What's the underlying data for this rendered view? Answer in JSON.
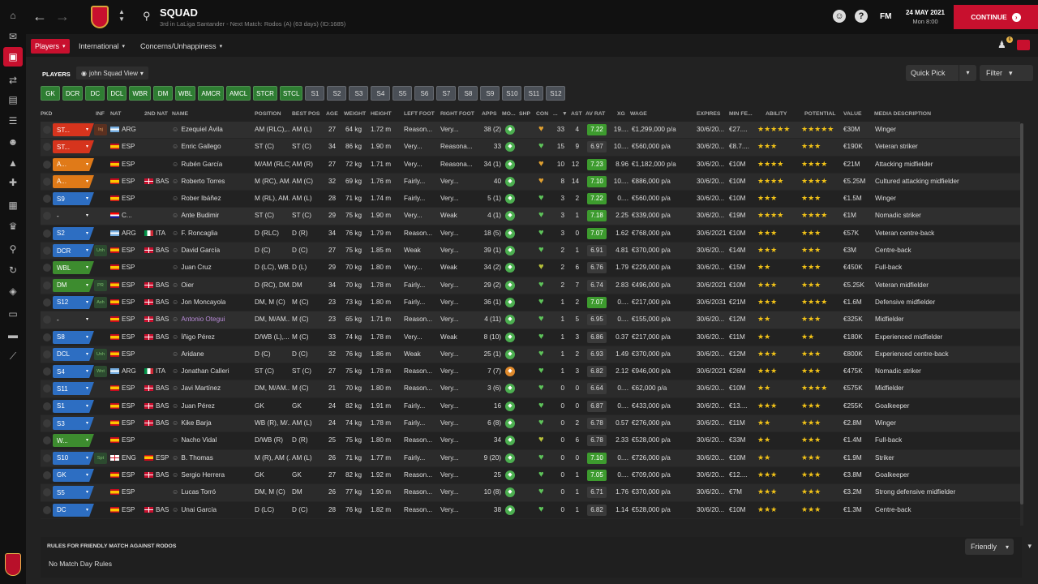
{
  "window": {
    "title": "SQUAD",
    "subtitle": "3rd in LaLiga Santander - Next Match: Rodos (A) (63 days) (ID:1685)",
    "date": "24 MAY 2021",
    "time": "Mon 8:00",
    "fm": "FM",
    "continue": "CONTINUE",
    "badge_count": "6"
  },
  "menus": {
    "players": "Players",
    "international": "International",
    "concerns": "Concerns/Unhappiness"
  },
  "list": {
    "heading": "PLAYERS",
    "view": "john Squad View",
    "quickpick": "Quick Pick",
    "filter": "Filter"
  },
  "positions": [
    "GK",
    "DCR",
    "DC",
    "DCL",
    "WBR",
    "DM",
    "WBL",
    "AMCR",
    "AMCL",
    "STCR",
    "STCL"
  ],
  "slots": [
    "S1",
    "S2",
    "S3",
    "S4",
    "S5",
    "S6",
    "S7",
    "S8",
    "S9",
    "S10",
    "S11",
    "S12"
  ],
  "columns": {
    "pkd": "PKD",
    "inf": "INF",
    "nat": "NAT",
    "nat2": "2ND NAT",
    "name": "NAME",
    "position": "POSITION",
    "bestpos": "BEST POS",
    "age": "AGE",
    "weight": "WEIGHT",
    "height": "HEIGHT",
    "lfoot": "LEFT FOOT",
    "rfoot": "RIGHT FOOT",
    "apps": "APPS",
    "mo": "MO...",
    "shp": "SHP",
    "con": "CON",
    "gls": "...",
    "ast": "AST",
    "avrat": "AV RAT",
    "xg": "XG",
    "wage": "WAGE",
    "expires": "EXPIRES",
    "minfee": "MIN FE...",
    "ability": "ABILITY",
    "potential": "POTENTIAL",
    "value": "VALUE",
    "media": "MEDIA DESCRIPTION"
  },
  "colors": {
    "accent": "#c8102e",
    "green": "#2e7d32",
    "slot": "#4a4f56"
  },
  "players": [
    {
      "pkd": "ST...",
      "pc": "red",
      "inf": "Inj",
      "ic": "red",
      "nat": "ARG",
      "nf": "arg",
      "nat2": "",
      "n2f": "",
      "name": "Ezequiel Ávila",
      "pos": "AM (RLC),...",
      "best": "AM (L)",
      "age": "27",
      "wt": "64 kg",
      "ht": "1.72 m",
      "lf": "Reason...",
      "rf": "Very...",
      "apps": "38 (2)",
      "mor": "g",
      "con": "o",
      "gls": "33",
      "ast": "4",
      "av": "7.22",
      "avc": "g",
      "xg": "19....",
      "wage": "€1,299,000 p/a",
      "exp": "30/6/20...",
      "fee": "€27....",
      "ab": "5",
      "po": "5",
      "val": "€30M",
      "media": "Winger",
      "sel": true
    },
    {
      "pkd": "ST...",
      "pc": "red",
      "inf": "",
      "ic": "",
      "nat": "ESP",
      "nf": "esp",
      "nat2": "",
      "n2f": "",
      "name": "Enric Gallego",
      "pos": "ST (C)",
      "best": "ST (C)",
      "age": "34",
      "wt": "86 kg",
      "ht": "1.90 m",
      "lf": "Very...",
      "rf": "Reasona...",
      "apps": "33",
      "mor": "g",
      "con": "g",
      "gls": "15",
      "ast": "9",
      "av": "6.97",
      "avc": "n",
      "xg": "10....",
      "wage": "€560,000 p/a",
      "exp": "30/6/20...",
      "fee": "€8.7....",
      "ab": "3",
      "po": "3",
      "val": "€190K",
      "media": "Veteran striker"
    },
    {
      "pkd": "A...",
      "pc": "ora",
      "inf": "",
      "ic": "",
      "nat": "ESP",
      "nf": "esp",
      "nat2": "",
      "n2f": "",
      "name": "Rubén García",
      "pos": "M/AM (RLC)",
      "best": "AM (R)",
      "age": "27",
      "wt": "72 kg",
      "ht": "1.71 m",
      "lf": "Very...",
      "rf": "Reasona...",
      "apps": "34 (1)",
      "mor": "g",
      "con": "o",
      "gls": "10",
      "ast": "12",
      "av": "7.23",
      "avc": "g",
      "xg": "8.96",
      "wage": "€1,182,000 p/a",
      "exp": "30/6/20...",
      "fee": "€10M",
      "ab": "4",
      "po": "4",
      "val": "€21M",
      "media": "Attacking midfielder"
    },
    {
      "pkd": "A...",
      "pc": "ora",
      "inf": "",
      "ic": "",
      "nat": "ESP",
      "nf": "esp",
      "nat2": "BAS",
      "n2f": "bas",
      "name": "Roberto Torres",
      "pos": "M (RC), AM...",
      "best": "AM (C)",
      "age": "32",
      "wt": "69 kg",
      "ht": "1.76 m",
      "lf": "Fairly...",
      "rf": "Very...",
      "apps": "40",
      "mor": "g",
      "con": "o",
      "gls": "8",
      "ast": "14",
      "av": "7.10",
      "avc": "g",
      "xg": "10....",
      "wage": "€886,000 p/a",
      "exp": "30/6/20...",
      "fee": "€10M",
      "ab": "4",
      "po": "4",
      "val": "€5.25M",
      "media": "Cultured attacking midfielder"
    },
    {
      "pkd": "S9",
      "pc": "blu",
      "inf": "",
      "ic": "",
      "nat": "ESP",
      "nf": "esp",
      "nat2": "",
      "n2f": "",
      "name": "Rober Ibáñez",
      "pos": "M (RL), AM...",
      "best": "AM (L)",
      "age": "28",
      "wt": "71 kg",
      "ht": "1.74 m",
      "lf": "Fairly...",
      "rf": "Very...",
      "apps": "5 (1)",
      "mor": "g",
      "con": "g",
      "gls": "3",
      "ast": "2",
      "av": "7.22",
      "avc": "g",
      "xg": "0....",
      "wage": "€560,000 p/a",
      "exp": "30/6/20...",
      "fee": "€10M",
      "ab": "3.5",
      "po": "3.5",
      "val": "€1.5M",
      "media": "Winger"
    },
    {
      "pkd": "-",
      "pc": "none",
      "inf": "",
      "ic": "",
      "nat": "C...",
      "nf": "cro",
      "nat2": "",
      "n2f": "",
      "name": "Ante Budimir",
      "pos": "ST (C)",
      "best": "ST (C)",
      "age": "29",
      "wt": "75 kg",
      "ht": "1.90 m",
      "lf": "Very...",
      "rf": "Weak",
      "apps": "4 (1)",
      "mor": "g",
      "con": "g",
      "gls": "3",
      "ast": "1",
      "av": "7.18",
      "avc": "g",
      "xg": "2.25",
      "wage": "€339,000 p/a",
      "exp": "30/6/20...",
      "fee": "€19M",
      "ab": "4",
      "po": "4",
      "val": "€1M",
      "media": "Nomadic striker",
      "sel": true
    },
    {
      "pkd": "S2",
      "pc": "blu",
      "inf": "",
      "ic": "",
      "nat": "ARG",
      "nf": "arg",
      "nat2": "ITA",
      "n2f": "ita",
      "name": "F. Roncaglia",
      "pos": "D (RLC)",
      "best": "D (R)",
      "age": "34",
      "wt": "76 kg",
      "ht": "1.79 m",
      "lf": "Reason...",
      "rf": "Very...",
      "apps": "18 (5)",
      "mor": "g",
      "con": "g",
      "gls": "3",
      "ast": "0",
      "av": "7.07",
      "avc": "g",
      "xg": "1.62",
      "wage": "€768,000 p/a",
      "exp": "30/6/2021",
      "fee": "€10M",
      "ab": "3",
      "po": "3",
      "val": "€57K",
      "media": "Veteran centre-back"
    },
    {
      "pkd": "DCR",
      "pc": "blu",
      "inf": "Unh",
      "ic": "grn",
      "nat": "ESP",
      "nf": "esp",
      "nat2": "BAS",
      "n2f": "bas",
      "name": "David García",
      "pos": "D (C)",
      "best": "D (C)",
      "age": "27",
      "wt": "75 kg",
      "ht": "1.85 m",
      "lf": "Weak",
      "rf": "Very...",
      "apps": "39 (1)",
      "mor": "g",
      "con": "g",
      "gls": "2",
      "ast": "1",
      "av": "6.91",
      "avc": "n",
      "xg": "4.81",
      "wage": "€370,000 p/a",
      "exp": "30/6/20...",
      "fee": "€14M",
      "ab": "3",
      "po": "3",
      "val": "€3M",
      "media": "Centre-back"
    },
    {
      "pkd": "WBL",
      "pc": "grn",
      "inf": "",
      "ic": "",
      "nat": "ESP",
      "nf": "esp",
      "nat2": "",
      "n2f": "",
      "name": "Juan Cruz",
      "pos": "D (LC), WB...",
      "best": "D (L)",
      "age": "29",
      "wt": "70 kg",
      "ht": "1.80 m",
      "lf": "Very...",
      "rf": "Weak",
      "apps": "34 (2)",
      "mor": "g",
      "con": "y",
      "gls": "2",
      "ast": "6",
      "av": "6.76",
      "avc": "n",
      "xg": "1.79",
      "wage": "€229,000 p/a",
      "exp": "30/6/20...",
      "fee": "€15M",
      "ab": "2.5",
      "po": "3.5",
      "val": "€450K",
      "media": "Full-back"
    },
    {
      "pkd": "DM",
      "pc": "grn",
      "inf": "PR",
      "ic": "grn",
      "nat": "ESP",
      "nf": "esp",
      "nat2": "BAS",
      "n2f": "bas",
      "name": "Oier",
      "pos": "D (RC), DM...",
      "best": "DM",
      "age": "34",
      "wt": "70 kg",
      "ht": "1.78 m",
      "lf": "Fairly...",
      "rf": "Very...",
      "apps": "29 (2)",
      "mor": "g",
      "con": "g",
      "gls": "2",
      "ast": "7",
      "av": "6.74",
      "avc": "n",
      "xg": "2.83",
      "wage": "€496,000 p/a",
      "exp": "30/6/2021",
      "fee": "€10M",
      "ab": "3",
      "po": "3",
      "val": "€5.25K",
      "media": "Veteran midfielder"
    },
    {
      "pkd": "S12",
      "pc": "blu",
      "inf": "Ash",
      "ic": "grn",
      "nat": "ESP",
      "nf": "esp",
      "nat2": "BAS",
      "n2f": "bas",
      "name": "Jon Moncayola",
      "pos": "DM, M (C)",
      "best": "M (C)",
      "age": "23",
      "wt": "73 kg",
      "ht": "1.80 m",
      "lf": "Fairly...",
      "rf": "Very...",
      "apps": "36 (1)",
      "mor": "g",
      "con": "g",
      "gls": "1",
      "ast": "2",
      "av": "7.07",
      "avc": "g",
      "xg": "0....",
      "wage": "€217,000 p/a",
      "exp": "30/6/2031",
      "fee": "€21M",
      "ab": "3",
      "po": "4",
      "val": "€1.6M",
      "media": "Defensive midfielder"
    },
    {
      "pkd": "-",
      "pc": "none",
      "inf": "",
      "ic": "",
      "nat": "ESP",
      "nf": "esp",
      "nat2": "BAS",
      "n2f": "bas",
      "name": "Antonio Otegui",
      "pos": "DM, M/AM...",
      "best": "M (C)",
      "age": "23",
      "wt": "65 kg",
      "ht": "1.71 m",
      "lf": "Reason...",
      "rf": "Very...",
      "apps": "4 (11)",
      "mor": "g",
      "con": "g",
      "gls": "1",
      "ast": "5",
      "av": "6.95",
      "avc": "n",
      "xg": "0....",
      "wage": "€155,000 p/a",
      "exp": "30/6/20...",
      "fee": "€12M",
      "ab": "2.5",
      "po": "3",
      "val": "€325K",
      "media": "Midfielder",
      "sel": true,
      "purple": true
    },
    {
      "pkd": "S8",
      "pc": "blu",
      "inf": "",
      "ic": "",
      "nat": "ESP",
      "nf": "esp",
      "nat2": "BAS",
      "n2f": "bas",
      "name": "Íñigo Pérez",
      "pos": "D/WB (L),...",
      "best": "M (C)",
      "age": "33",
      "wt": "74 kg",
      "ht": "1.78 m",
      "lf": "Very...",
      "rf": "Weak",
      "apps": "8 (10)",
      "mor": "g",
      "con": "g",
      "gls": "1",
      "ast": "3",
      "av": "6.86",
      "avc": "n",
      "xg": "0.37",
      "wage": "€217,000 p/a",
      "exp": "30/6/20...",
      "fee": "€11M",
      "ab": "2.5",
      "po": "2.5",
      "val": "€180K",
      "media": "Experienced midfielder"
    },
    {
      "pkd": "DCL",
      "pc": "blu",
      "inf": "Unh",
      "ic": "grn",
      "nat": "ESP",
      "nf": "esp",
      "nat2": "",
      "n2f": "",
      "name": "Aridane",
      "pos": "D (C)",
      "best": "D (C)",
      "age": "32",
      "wt": "76 kg",
      "ht": "1.86 m",
      "lf": "Weak",
      "rf": "Very...",
      "apps": "25 (1)",
      "mor": "g",
      "con": "g",
      "gls": "1",
      "ast": "2",
      "av": "6.93",
      "avc": "n",
      "xg": "1.49",
      "wage": "€370,000 p/a",
      "exp": "30/6/20...",
      "fee": "€12M",
      "ab": "3",
      "po": "3",
      "val": "€800K",
      "media": "Experienced centre-back"
    },
    {
      "pkd": "S4",
      "pc": "blu",
      "inf": "Wnt",
      "ic": "grn",
      "nat": "ARG",
      "nf": "arg",
      "nat2": "ITA",
      "n2f": "ita",
      "name": "Jonathan Calleri",
      "pos": "ST (C)",
      "best": "ST (C)",
      "age": "27",
      "wt": "75 kg",
      "ht": "1.78 m",
      "lf": "Reason...",
      "rf": "Very...",
      "apps": "7 (7)",
      "mor": "o",
      "con": "g",
      "gls": "1",
      "ast": "3",
      "av": "6.82",
      "avc": "n",
      "xg": "2.12",
      "wage": "€946,000 p/a",
      "exp": "30/6/2021",
      "fee": "€26M",
      "ab": "3",
      "po": "3",
      "val": "€475K",
      "media": "Nomadic striker"
    },
    {
      "pkd": "S11",
      "pc": "blu",
      "inf": "",
      "ic": "",
      "nat": "ESP",
      "nf": "esp",
      "nat2": "BAS",
      "n2f": "bas",
      "name": "Javi Martínez",
      "pos": "DM, M/AM...",
      "best": "M (C)",
      "age": "21",
      "wt": "70 kg",
      "ht": "1.80 m",
      "lf": "Reason...",
      "rf": "Very...",
      "apps": "3 (6)",
      "mor": "g",
      "con": "g",
      "gls": "0",
      "ast": "0",
      "av": "6.64",
      "avc": "n",
      "xg": "0....",
      "wage": "€62,000 p/a",
      "exp": "30/6/20...",
      "fee": "€10M",
      "ab": "2.5",
      "po": "4.5",
      "val": "€575K",
      "media": "Midfielder"
    },
    {
      "pkd": "S1",
      "pc": "blu",
      "inf": "",
      "ic": "",
      "nat": "ESP",
      "nf": "esp",
      "nat2": "BAS",
      "n2f": "bas",
      "name": "Juan Pérez",
      "pos": "GK",
      "best": "GK",
      "age": "24",
      "wt": "82 kg",
      "ht": "1.91 m",
      "lf": "Fairly...",
      "rf": "Very...",
      "apps": "16",
      "mor": "g",
      "con": "g",
      "gls": "0",
      "ast": "0",
      "av": "6.87",
      "avc": "n",
      "xg": "0....",
      "wage": "€433,000 p/a",
      "exp": "30/6/20...",
      "fee": "€13....",
      "ab": "3",
      "po": "3",
      "val": "€255K",
      "media": "Goalkeeper"
    },
    {
      "pkd": "S3",
      "pc": "blu",
      "inf": "",
      "ic": "",
      "nat": "ESP",
      "nf": "esp",
      "nat2": "BAS",
      "n2f": "bas",
      "name": "Kike Barja",
      "pos": "WB (R), M/...",
      "best": "AM (L)",
      "age": "24",
      "wt": "74 kg",
      "ht": "1.78 m",
      "lf": "Fairly...",
      "rf": "Very...",
      "apps": "6 (8)",
      "mor": "g",
      "con": "g",
      "gls": "0",
      "ast": "2",
      "av": "6.78",
      "avc": "n",
      "xg": "0.57",
      "wage": "€276,000 p/a",
      "exp": "30/6/20...",
      "fee": "€11M",
      "ab": "2.5",
      "po": "3",
      "val": "€2.8M",
      "media": "Winger"
    },
    {
      "pkd": "W...",
      "pc": "grn",
      "inf": "",
      "ic": "",
      "nat": "ESP",
      "nf": "esp",
      "nat2": "",
      "n2f": "",
      "name": "Nacho Vidal",
      "pos": "D/WB (R)",
      "best": "D (R)",
      "age": "25",
      "wt": "75 kg",
      "ht": "1.80 m",
      "lf": "Reason...",
      "rf": "Very...",
      "apps": "34",
      "mor": "g",
      "con": "y",
      "gls": "0",
      "ast": "6",
      "av": "6.78",
      "avc": "n",
      "xg": "2.33",
      "wage": "€528,000 p/a",
      "exp": "30/6/20...",
      "fee": "€33M",
      "ab": "2.5",
      "po": "3.5",
      "val": "€1.4M",
      "media": "Full-back"
    },
    {
      "pkd": "S10",
      "pc": "blu",
      "inf": "Spt",
      "ic": "grn",
      "nat": "ENG",
      "nf": "eng",
      "nat2": "ESP",
      "n2f": "esp",
      "name": "B. Thomas",
      "pos": "M (R), AM (...",
      "best": "AM (L)",
      "age": "26",
      "wt": "71 kg",
      "ht": "1.77 m",
      "lf": "Fairly...",
      "rf": "Very...",
      "apps": "9 (20)",
      "mor": "g",
      "con": "g",
      "gls": "0",
      "ast": "0",
      "av": "7.10",
      "avc": "g",
      "xg": "0....",
      "wage": "€726,000 p/a",
      "exp": "30/6/20...",
      "fee": "€10M",
      "ab": "2.5",
      "po": "3",
      "val": "€1.9M",
      "media": "Striker"
    },
    {
      "pkd": "GK",
      "pc": "blu",
      "inf": "",
      "ic": "",
      "nat": "ESP",
      "nf": "esp",
      "nat2": "BAS",
      "n2f": "bas",
      "name": "Sergio Herrera",
      "pos": "GK",
      "best": "GK",
      "age": "27",
      "wt": "82 kg",
      "ht": "1.92 m",
      "lf": "Reason...",
      "rf": "Very...",
      "apps": "25",
      "mor": "g",
      "con": "g",
      "gls": "0",
      "ast": "1",
      "av": "7.05",
      "avc": "g",
      "xg": "0....",
      "wage": "€709,000 p/a",
      "exp": "30/6/20...",
      "fee": "€12....",
      "ab": "3",
      "po": "3",
      "val": "€3.8M",
      "media": "Goalkeeper"
    },
    {
      "pkd": "S5",
      "pc": "blu",
      "inf": "",
      "ic": "",
      "nat": "ESP",
      "nf": "esp",
      "nat2": "",
      "n2f": "",
      "name": "Lucas Torró",
      "pos": "DM, M (C)",
      "best": "DM",
      "age": "26",
      "wt": "77 kg",
      "ht": "1.90 m",
      "lf": "Reason...",
      "rf": "Very...",
      "apps": "10 (8)",
      "mor": "g",
      "con": "g",
      "gls": "0",
      "ast": "1",
      "av": "6.71",
      "avc": "n",
      "xg": "1.76",
      "wage": "€370,000 p/a",
      "exp": "30/6/20...",
      "fee": "€7M",
      "ab": "3",
      "po": "3",
      "val": "€3.2M",
      "media": "Strong defensive midfielder"
    },
    {
      "pkd": "DC",
      "pc": "blu",
      "inf": "",
      "ic": "",
      "nat": "ESP",
      "nf": "esp",
      "nat2": "BAS",
      "n2f": "bas",
      "name": "Unai García",
      "pos": "D (LC)",
      "best": "D (C)",
      "age": "28",
      "wt": "76 kg",
      "ht": "1.82 m",
      "lf": "Reason...",
      "rf": "Very...",
      "apps": "38",
      "mor": "g",
      "con": "g",
      "gls": "0",
      "ast": "1",
      "av": "6.82",
      "avc": "n",
      "xg": "1.14",
      "wage": "€528,000 p/a",
      "exp": "30/6/20...",
      "fee": "€10M",
      "ab": "3",
      "po": "3",
      "val": "€1.3M",
      "media": "Centre-back"
    }
  ],
  "rules": {
    "title": "RULES FOR FRIENDLY MATCH AGAINST RODOS",
    "text": "No Match Day Rules",
    "dropdown": "Friendly"
  }
}
